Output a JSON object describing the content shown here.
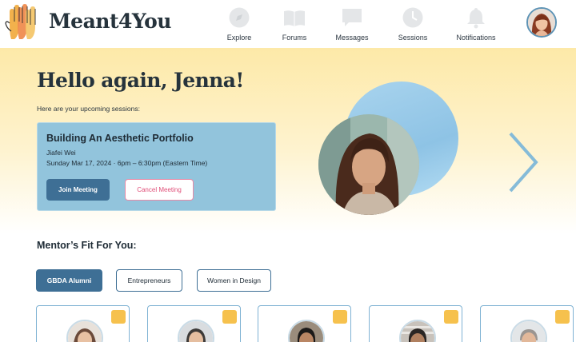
{
  "app": {
    "name": "Meant4You",
    "logo_icon": "raised-hands-icon"
  },
  "nav": [
    {
      "label": "Explore",
      "icon": "compass-icon"
    },
    {
      "label": "Forums",
      "icon": "book-icon"
    },
    {
      "label": "Messages",
      "icon": "message-icon"
    },
    {
      "label": "Sessions",
      "icon": "clock-icon"
    },
    {
      "label": "Notifications",
      "icon": "bell-icon"
    }
  ],
  "user": {
    "avatar": "user-avatar"
  },
  "hero": {
    "greeting": "Hello again, Jenna!",
    "subtitle": "Here are your upcoming sessions:"
  },
  "session": {
    "title": "Building An Aesthetic Portfolio",
    "mentor": "Jiafei Wei",
    "time": "Sunday Mar 17, 2024 · 6pm – 6:30pm (Eastern Time)",
    "join_label": "Join Meeting",
    "cancel_label": "Cancel Meeting"
  },
  "mentors": {
    "title": "Mentor’s Fit For You:",
    "filters": [
      {
        "label": "GBDA Alumni",
        "active": true
      },
      {
        "label": "Entrepreneurs",
        "active": false
      },
      {
        "label": "Women in Design",
        "active": false
      }
    ],
    "cards": [
      {
        "bookmark": true
      },
      {
        "bookmark": true
      },
      {
        "bookmark": true
      },
      {
        "bookmark": true
      },
      {
        "bookmark": true
      }
    ]
  },
  "colors": {
    "accent": "#3e6f95",
    "card_blue": "#92c4dc",
    "cancel_pink": "#e04f79",
    "bookmark_yellow": "#f6c14d",
    "hero_yellow": "#fde9a8"
  }
}
